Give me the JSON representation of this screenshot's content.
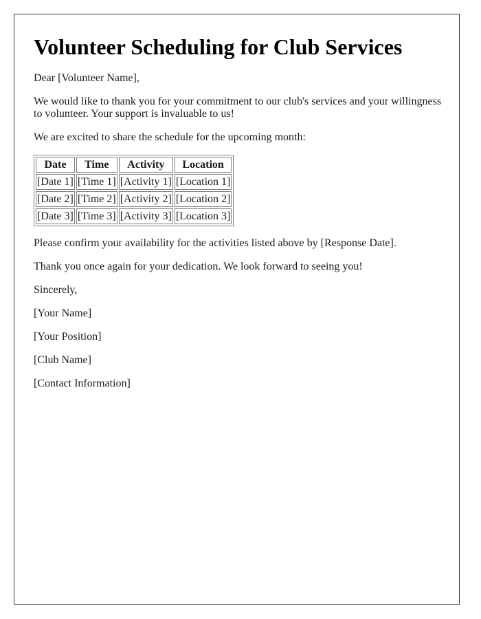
{
  "letter": {
    "title": "Volunteer Scheduling for Club Services",
    "salutation": "Dear [Volunteer Name],",
    "paragraph_thanks": "We would like to thank you for your commitment to our club's services and your willingness to volunteer. Your support is invaluable to us!",
    "paragraph_intro": "We are excited to share the schedule for the upcoming month:",
    "schedule": {
      "headers": [
        "Date",
        "Time",
        "Activity",
        "Location"
      ],
      "rows": [
        [
          "[Date 1]",
          "[Time 1]",
          "[Activity 1]",
          "[Location 1]"
        ],
        [
          "[Date 2]",
          "[Time 2]",
          "[Activity 2]",
          "[Location 2]"
        ],
        [
          "[Date 3]",
          "[Time 3]",
          "[Activity 3]",
          "[Location 3]"
        ]
      ]
    },
    "paragraph_confirm": "Please confirm your availability for the activities listed above by [Response Date].",
    "paragraph_closing": "Thank you once again for your dedication. We look forward to seeing you!",
    "signoff": "Sincerely,",
    "signature": {
      "name": "[Your Name]",
      "position": "[Your Position]",
      "club": "[Club Name]",
      "contact": "[Contact Information]"
    }
  }
}
